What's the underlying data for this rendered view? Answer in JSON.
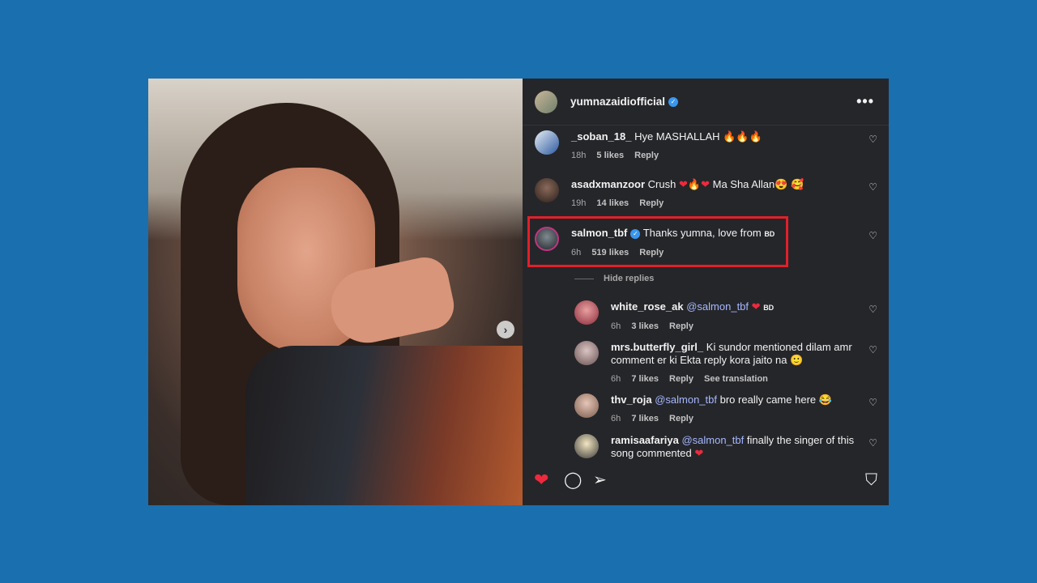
{
  "post": {
    "username": "yumnazaidiofficial",
    "more_label": "•••",
    "next_label": "›"
  },
  "comments": [
    {
      "user": "_soban_18_",
      "text": "Hye MASHALLAH",
      "emoji": "🔥🔥🔥",
      "time": "18h",
      "likes": "5 likes",
      "reply": "Reply"
    },
    {
      "user": "asadxmanzoor",
      "text_a": "Crush",
      "emoji_a": "❤",
      "emoji_b": "🔥",
      "emoji_c": "❤",
      "text_b": "Ma Sha Allan",
      "emoji_d": "😍 🥰",
      "time": "19h",
      "likes": "14 likes",
      "reply": "Reply"
    },
    {
      "user": "salmon_tbf",
      "text": "Thanks yumna, love from",
      "flag": "BD",
      "time": "6h",
      "likes": "519 likes",
      "reply": "Reply"
    }
  ],
  "hide_replies": "Hide replies",
  "replies": [
    {
      "user": "white_rose_ak",
      "mention": "@salmon_tbf",
      "emoji": "❤",
      "flag": "BD",
      "time": "6h",
      "likes": "3 likes",
      "reply": "Reply"
    },
    {
      "user": "mrs.butterfly_girl_",
      "text": "Ki sundor mentioned dilam amr comment er ki Ekta reply kora jaito na",
      "emoji": "🙂",
      "time": "6h",
      "likes": "7 likes",
      "reply": "Reply",
      "translate": "See translation"
    },
    {
      "user": "thv_roja",
      "mention": "@salmon_tbf",
      "text": "bro really came here",
      "emoji": "😂",
      "time": "6h",
      "likes": "7 likes",
      "reply": "Reply"
    },
    {
      "user": "ramisaafariya",
      "mention": "@salmon_tbf",
      "text": "finally the singer of this song commented",
      "emoji": "❤"
    }
  ],
  "icons": {
    "heart_small": "♡",
    "like_filled": "❤",
    "comment": "◯",
    "share": "➢",
    "save": "⛉",
    "verified": "✓"
  },
  "colors": {
    "background": "#1a6faf",
    "panel": "#25262a",
    "highlight": "#e0202a",
    "like": "#ed2a3d",
    "mention": "#a5b8ff",
    "verified": "#3897f0"
  }
}
